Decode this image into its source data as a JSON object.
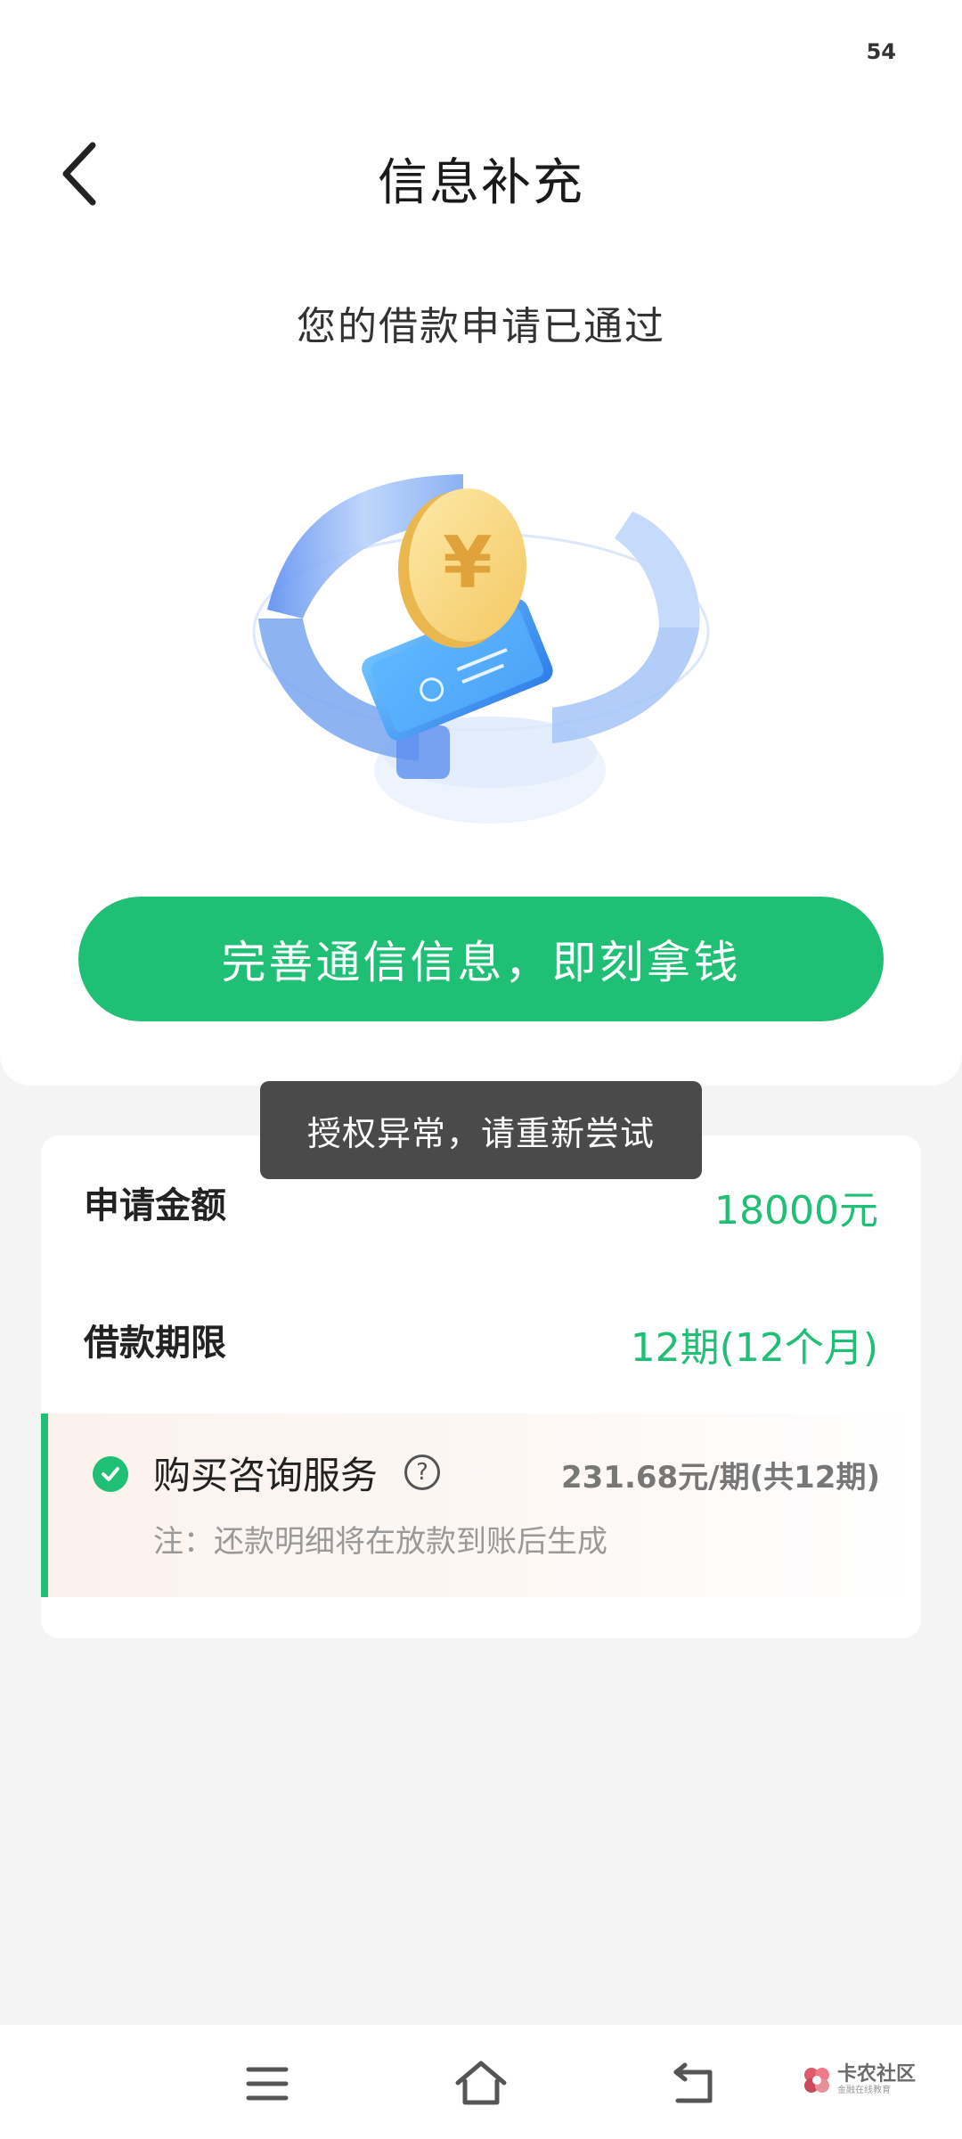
{
  "status_bar": {
    "battery": "54"
  },
  "header": {
    "title": "信息补充",
    "back_icon": "chevron-left-icon"
  },
  "hero": {
    "approved_text": "您的借款申请已通过",
    "illustration": "coin-phone-illustration",
    "coin_symbol": "¥",
    "cta_label": "完善通信信息，即刻拿钱",
    "accent_color": "#1fbf75"
  },
  "toast": {
    "message": "授权异常，请重新尝试"
  },
  "loan": {
    "amount_label": "申请金额",
    "amount_value": "18000元",
    "term_label": "借款期限",
    "term_value": "12期(12个月)"
  },
  "service": {
    "check_icon": "check-circle-icon",
    "label": "购买咨询服务",
    "help_icon": "question-circle-icon",
    "help_symbol": "?",
    "price": "231.68元/期(共12期)",
    "note": "注：还款明细将在放款到账后生成"
  },
  "system_nav": {
    "menu_icon": "menu-icon",
    "home_icon": "home-icon",
    "back_icon": "back-icon"
  },
  "watermark": {
    "main": "卡农社区",
    "sub": "金融在线教育"
  }
}
